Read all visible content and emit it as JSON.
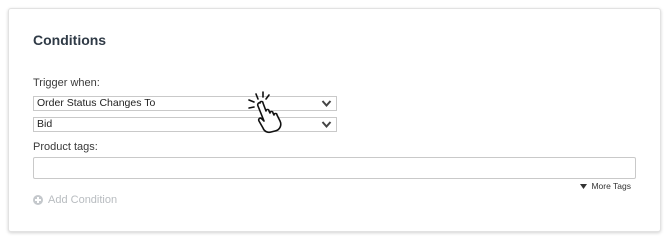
{
  "conditions": {
    "title": "Conditions",
    "trigger_label": "Trigger when:",
    "trigger_select_value": "Order Status Changes To",
    "status_select_value": "Bid",
    "product_tags_label": "Product tags:",
    "product_tags_value": "",
    "more_tags_label": "More Tags",
    "add_condition_label": "Add Condition"
  },
  "icons": {
    "chevron": "chevron-down-icon",
    "more_tags": "caret-down-icon",
    "add": "plus-circle-icon",
    "cursor": "hand-pointer-icon"
  }
}
